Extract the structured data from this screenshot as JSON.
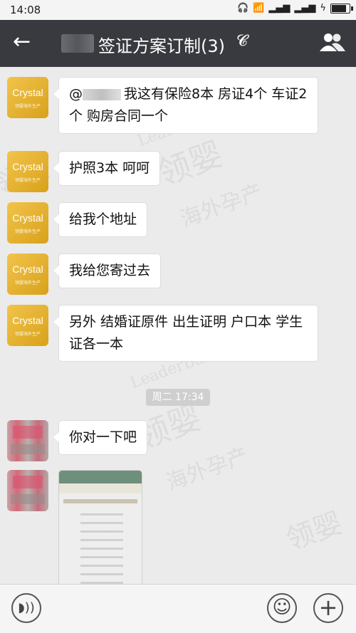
{
  "status": {
    "time": "14:08",
    "battery_percent": 85
  },
  "header": {
    "title": "签证方案订制(3)"
  },
  "avatar_brand": "Crystal",
  "avatar_sub": "领婴海外生产",
  "messages": [
    {
      "text_after_mention": "我这有保险8本 房证4个 车证2个 购房合同一个",
      "at": "@"
    },
    {
      "text": "护照3本 呵呵"
    },
    {
      "text": "给我个地址"
    },
    {
      "text": "我给您寄过去"
    },
    {
      "text": "另外 结婚证原件  出生证明 户口本 学生证各一本"
    }
  ],
  "time_chip": "周二 17:34",
  "user_messages": [
    {
      "text": "你对一下吧"
    }
  ],
  "watermark": {
    "lines": [
      "领婴",
      "海外孕产",
      "LeaderBaby"
    ]
  },
  "icons": {
    "back": "back-arrow-icon",
    "ear": "earpiece-icon",
    "people": "group-members-icon",
    "voice": "voice-icon",
    "emoji": "emoji-icon",
    "plus": "plus-icon"
  }
}
